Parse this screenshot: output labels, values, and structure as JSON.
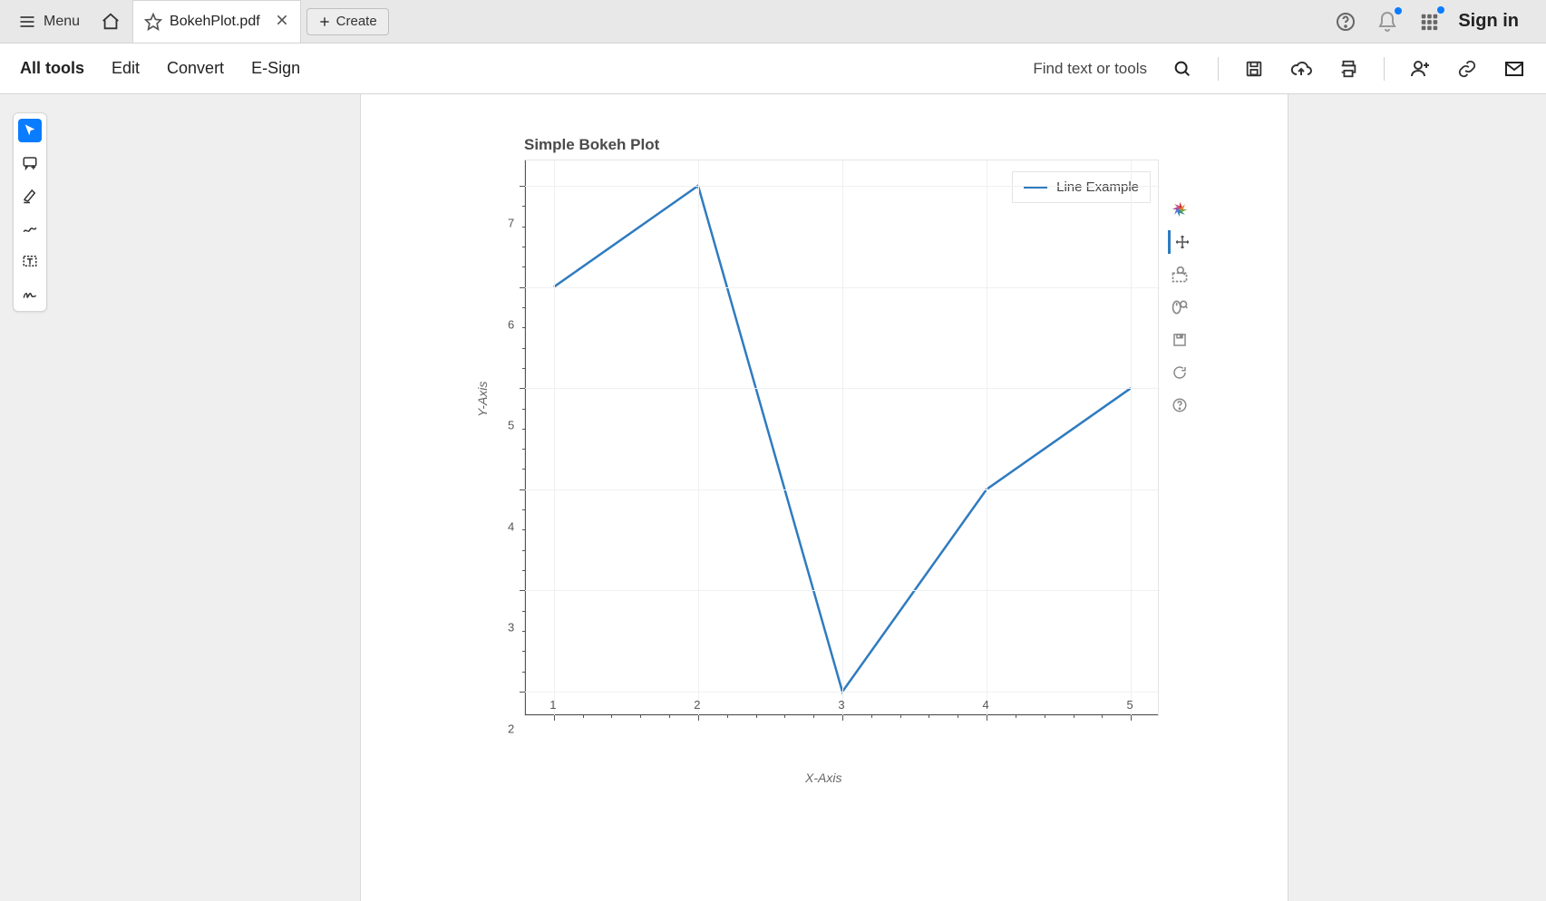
{
  "tabbar": {
    "menu_label": "Menu",
    "create_label": "Create",
    "tab_title": "BokehPlot.pdf",
    "signin_label": "Sign in"
  },
  "toolbar": {
    "all_tools": "All tools",
    "edit": "Edit",
    "convert": "Convert",
    "esign": "E-Sign",
    "find_placeholder": "Find text or tools"
  },
  "chart_data": {
    "type": "line",
    "title": "Simple Bokeh Plot",
    "xlabel": "X-Axis",
    "ylabel": "Y-Axis",
    "legend": "Line Example",
    "series": [
      {
        "name": "Line Example",
        "x": [
          1,
          2,
          3,
          4,
          5
        ],
        "y": [
          6,
          7,
          2,
          4,
          5
        ]
      }
    ],
    "xticks": [
      1,
      2,
      3,
      4,
      5
    ],
    "yticks": [
      2,
      3,
      4,
      5,
      6,
      7
    ],
    "xlim": [
      0.8,
      5.2
    ],
    "ylim": [
      1.75,
      7.25
    ]
  },
  "bokeh_tools": [
    "logo",
    "pan",
    "box-zoom",
    "wheel-zoom",
    "save",
    "reset",
    "help"
  ]
}
